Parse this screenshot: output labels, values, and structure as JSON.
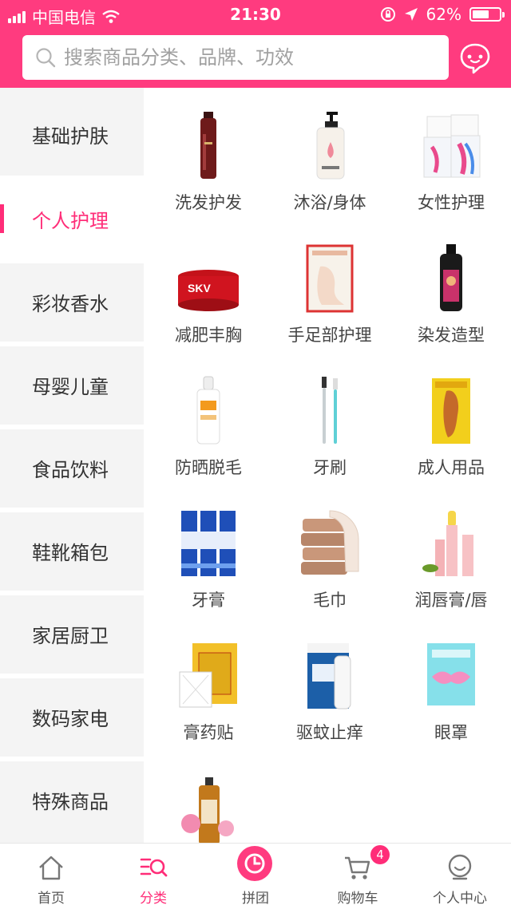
{
  "status_bar": {
    "carrier": "中国电信",
    "time": "21:30",
    "battery": "62%",
    "battery_level": 0.62
  },
  "search": {
    "placeholder": "搜索商品分类、品牌、功效"
  },
  "sidebar": {
    "items": [
      {
        "label": "基础护肤",
        "active": false
      },
      {
        "label": "个人护理",
        "active": true
      },
      {
        "label": "彩妆香水",
        "active": false
      },
      {
        "label": "母婴儿童",
        "active": false
      },
      {
        "label": "食品饮料",
        "active": false
      },
      {
        "label": "鞋靴箱包",
        "active": false
      },
      {
        "label": "家居厨卫",
        "active": false
      },
      {
        "label": "数码家电",
        "active": false
      },
      {
        "label": "特殊商品",
        "active": false
      }
    ]
  },
  "subcategories": [
    {
      "label": "洗发护发",
      "icon": "shampoo-bottle-icon"
    },
    {
      "label": "沐浴/身体",
      "icon": "body-wash-bottle-icon"
    },
    {
      "label": "女性护理",
      "icon": "sanitary-pads-icon"
    },
    {
      "label": "减肥丰胸",
      "icon": "cream-jar-icon"
    },
    {
      "label": "手足部护理",
      "icon": "foot-mask-icon"
    },
    {
      "label": "染发造型",
      "icon": "hair-dye-bottle-icon"
    },
    {
      "label": "防晒脱毛",
      "icon": "sunscreen-spray-icon"
    },
    {
      "label": "牙刷",
      "icon": "toothbrush-icon"
    },
    {
      "label": "成人用品",
      "icon": "adult-product-box-icon"
    },
    {
      "label": "牙膏",
      "icon": "toothpaste-icon"
    },
    {
      "label": "毛巾",
      "icon": "towel-icon"
    },
    {
      "label": "润唇膏/唇",
      "icon": "lip-balm-icon"
    },
    {
      "label": "膏药贴",
      "icon": "plaster-patch-icon"
    },
    {
      "label": "驱蚊止痒",
      "icon": "mosquito-repellent-icon"
    },
    {
      "label": "眼罩",
      "icon": "eye-mask-icon"
    },
    {
      "label": "",
      "icon": "essential-oil-bottle-icon"
    }
  ],
  "tabbar": {
    "items": [
      {
        "label": "首页",
        "icon": "home-icon",
        "active": false
      },
      {
        "label": "分类",
        "icon": "category-search-icon",
        "active": true
      },
      {
        "label": "拼团",
        "icon": "group-buy-clock-icon",
        "active": false
      },
      {
        "label": "购物车",
        "icon": "cart-icon",
        "active": false,
        "badge": "4"
      },
      {
        "label": "个人中心",
        "icon": "profile-icon",
        "active": false
      }
    ]
  },
  "colors": {
    "brand": "#ff3b7f",
    "active": "#ff2d78",
    "sidebar_bg": "#f4f4f4"
  }
}
